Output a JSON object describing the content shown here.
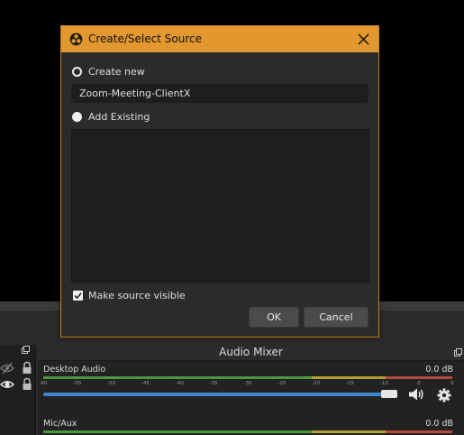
{
  "dialog": {
    "title": "Create/Select Source",
    "create_new_label": "Create new",
    "name_value": "Zoom-Meeting-ClientX",
    "add_existing_label": "Add Existing",
    "make_visible_label": "Make source visible",
    "make_visible_checked": true,
    "create_new_selected": true,
    "ok_label": "OK",
    "cancel_label": "Cancel",
    "accent_color": "#e2982f"
  },
  "mixer": {
    "title": "Audio Mixer",
    "tracks": [
      {
        "name": "Desktop Audio",
        "db": "0.0 dB",
        "volume_fraction": 1.0,
        "ticks": [
          "-60",
          "-55",
          "-50",
          "-45",
          "-40",
          "-35",
          "-30",
          "-25",
          "-20",
          "-15",
          "-10",
          "-5",
          "0"
        ]
      },
      {
        "name": "Mic/Aux",
        "db": "0.0 dB"
      }
    ],
    "meter_colors": {
      "green": "#4a9a3c",
      "yellow": "#b5a033",
      "red": "#b84a3c",
      "slider": "#3d86d1"
    }
  },
  "icons": [
    "obs-logo-icon",
    "close-icon",
    "float-icon",
    "eye-hidden-icon",
    "eye-icon",
    "lock-icon",
    "speaker-icon",
    "gear-icon"
  ]
}
